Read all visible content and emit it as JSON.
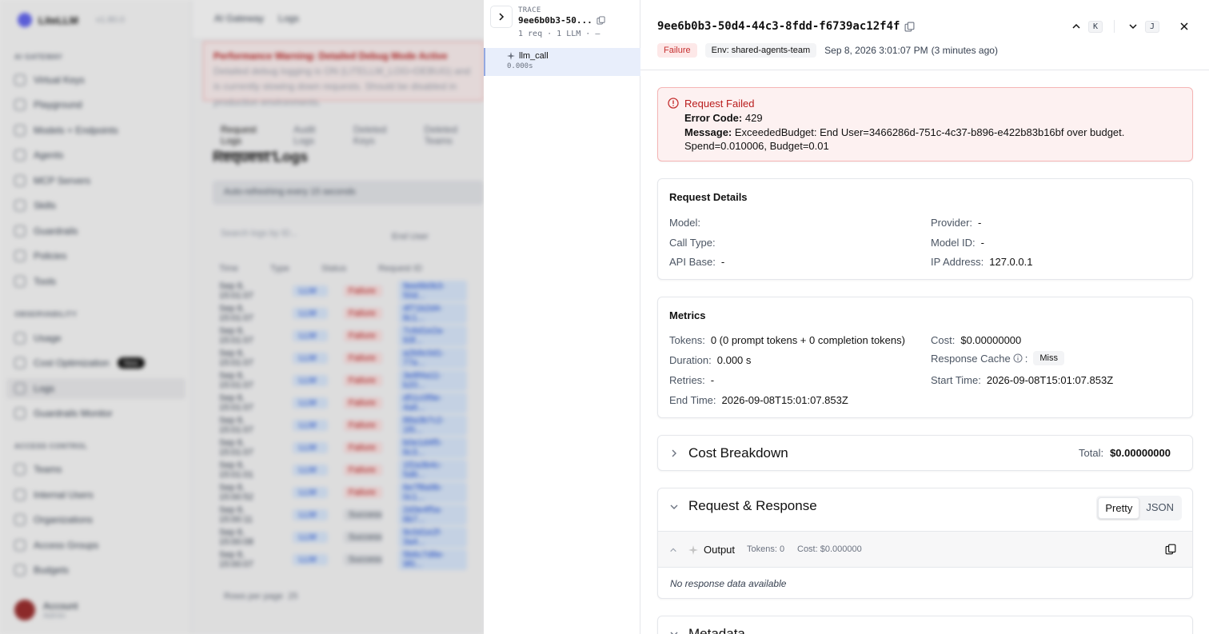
{
  "background": {
    "brand": "LiteLLM",
    "version": "v1.80.0",
    "breadcrumb": [
      "AI Gateway",
      "Logs"
    ],
    "sections": [
      "AI GATEWAY",
      "OBSERVABILITY",
      "ACCESS CONTROL"
    ],
    "nav_gateway": [
      "Virtual Keys",
      "Playground",
      "Models + Endpoints",
      "Agents",
      "MCP Servers",
      "Skills",
      "Guardrails",
      "Policies",
      "Tools"
    ],
    "nav_observability": [
      "Usage",
      "Cost Optimization",
      "Logs",
      "Guardrails Monitor"
    ],
    "nav_access": [
      "Teams",
      "Internal Users",
      "Organizations",
      "Access Groups",
      "Budgets"
    ],
    "new_badge": "New",
    "user_name": "Account",
    "user_role": "Admin",
    "warning_title": "Performance Warning: Detailed Debug Mode Active",
    "warning_text": "Detailed debug logging is ON (LITELLM_LOG=DEBUG) and is currently slowing down requests. Should be disabled in production environments.",
    "tabs": [
      "Request Logs",
      "Audit Logs",
      "Deleted Keys",
      "Deleted Teams"
    ],
    "page_title": "Request Logs",
    "refresh_text": "Auto-refreshing every 15 seconds",
    "search_placeholder": "Search logs by ID...",
    "end_user_label": "End User",
    "columns": [
      "Time",
      "Type",
      "Status",
      "Request ID"
    ],
    "rows": [
      {
        "time": "Sep 8, 15:01:07",
        "type": "LLM",
        "status": "Failure",
        "id": "9ee6b0b3-50d..."
      },
      {
        "time": "Sep 8, 15:01:07",
        "type": "LLM",
        "status": "Failure",
        "id": "4f71b2d4-8c1..."
      },
      {
        "time": "Sep 8, 15:01:07",
        "type": "LLM",
        "status": "Failure",
        "id": "7c6d1e2a-93f..."
      },
      {
        "time": "Sep 8, 15:01:07",
        "type": "LLM",
        "status": "Failure",
        "id": "a2b9c0d1-77e..."
      },
      {
        "time": "Sep 8, 15:01:07",
        "type": "LLM",
        "status": "Failure",
        "id": "3e8f4a11-b20..."
      },
      {
        "time": "Sep 8, 15:01:07",
        "type": "LLM",
        "status": "Failure",
        "id": "d51c0f9e-4a6..."
      },
      {
        "time": "Sep 8, 15:01:07",
        "type": "LLM",
        "status": "Failure",
        "id": "88a3b7c2-1f0..."
      },
      {
        "time": "Sep 8, 15:01:07",
        "type": "LLM",
        "status": "Failure",
        "id": "b0e1d4f5-6c3..."
      },
      {
        "time": "Sep 8, 15:01:01",
        "type": "LLM",
        "status": "Failure",
        "id": "1f2a3b4c-5d6..."
      },
      {
        "time": "Sep 8, 15:00:52",
        "type": "LLM",
        "status": "Failure",
        "id": "6e7f8a9b-0c1..."
      },
      {
        "time": "Sep 8, 15:00:11",
        "type": "LLM",
        "status": "Success",
        "id": "2d3e4f5a-6b7..."
      },
      {
        "time": "Sep 8, 15:00:08",
        "type": "LLM",
        "status": "Success",
        "id": "9c0d1e2f-3a4..."
      },
      {
        "time": "Sep 8, 15:00:07",
        "type": "LLM",
        "status": "Success",
        "id": "5b6c7d8e-9f0..."
      }
    ],
    "rows_per_page_label": "Rows per page",
    "rows_per_page_value": "25"
  },
  "trace": {
    "label": "TRACE",
    "id": "9ee6b0b3-50...",
    "summary": "1 req · 1 LLM · –",
    "span_name": "llm_call",
    "span_duration": "0.000s"
  },
  "detail": {
    "request_id": "9ee6b0b3-50d4-44c3-8fdd-f6739ac12f4f",
    "status": "Failure",
    "env": "Env: shared-agents-team",
    "timestamp": "Sep 8, 2026 3:01:07 PM",
    "relative": "(3 minutes ago)",
    "prev_key": "K",
    "next_key": "J",
    "error": {
      "title": "Request Failed",
      "code_label": "Error Code:",
      "code": "429",
      "message_label": "Message:",
      "message": "ExceededBudget: End User=3466286d-751c-4c37-b896-e422b83b16bf over budget. Spend=0.010006, Budget=0.01"
    },
    "request_details": {
      "title": "Request Details",
      "model_label": "Model:",
      "model": "",
      "provider_label": "Provider:",
      "provider": "-",
      "call_type_label": "Call Type:",
      "call_type": "",
      "model_id_label": "Model ID:",
      "model_id": "-",
      "api_base_label": "API Base:",
      "api_base": "-",
      "ip_label": "IP Address:",
      "ip": "127.0.0.1"
    },
    "metrics": {
      "title": "Metrics",
      "tokens_label": "Tokens:",
      "tokens": "0 (0 prompt tokens + 0 completion tokens)",
      "cost_label": "Cost:",
      "cost": "$0.00000000",
      "duration_label": "Duration:",
      "duration": "0.000 s",
      "cache_label": "Response Cache",
      "cache": "Miss",
      "retries_label": "Retries:",
      "retries": "-",
      "start_label": "Start Time:",
      "start": "2026-09-08T15:01:07.853Z",
      "end_label": "End Time:",
      "end": "2026-09-08T15:01:07.853Z"
    },
    "cost_breakdown": {
      "title": "Cost Breakdown",
      "total_label": "Total:",
      "total": "$0.00000000"
    },
    "request_response": {
      "title": "Request & Response",
      "view_options": [
        "Pretty",
        "JSON"
      ],
      "output_title": "Output",
      "output_tokens": "Tokens: 0",
      "output_cost": "Cost: $0.000000",
      "empty_text": "No response data available"
    },
    "metadata_title": "Metadata"
  },
  "colors": {
    "failure_bg": "#fde8e8",
    "failure_text": "#c53030",
    "error_card_bg": "#fdf1f1",
    "trace_span_bg": "#e8eefb"
  }
}
